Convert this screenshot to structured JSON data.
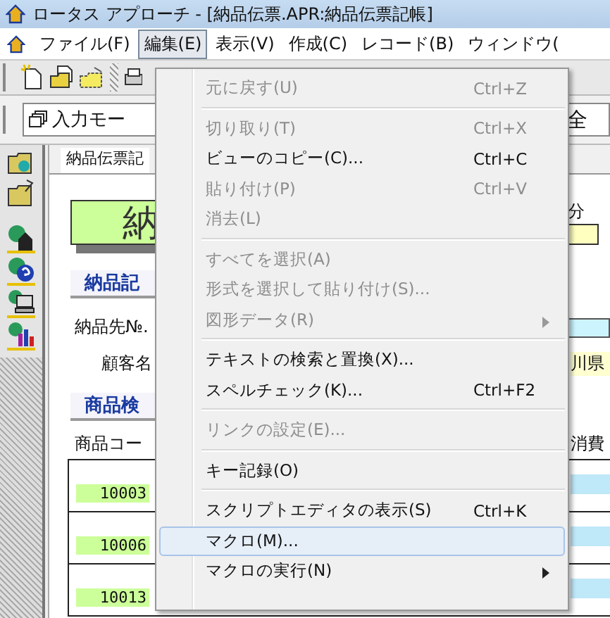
{
  "window": {
    "title": "ロータス アプローチ - [納品伝票.APR:納品伝票記帳]"
  },
  "menubar": [
    {
      "label": "ファイル(F)",
      "selected": false
    },
    {
      "label": "編集(E)",
      "selected": true
    },
    {
      "label": "表示(V)",
      "selected": false
    },
    {
      "label": "作成(C)",
      "selected": false
    },
    {
      "label": "レコード(B)",
      "selected": false
    },
    {
      "label": "ウィンドウ(",
      "selected": false
    }
  ],
  "toolbar": {
    "mode_field": "入力モー",
    "view_field": "全"
  },
  "form": {
    "tab": "納品伝票記",
    "title": "納",
    "section_1": "納品記",
    "label_1": "納品先№.",
    "label_2": "顧客名",
    "section_2": "商品検",
    "column": "商品コー",
    "right_label": "分",
    "customer_value": "川県",
    "right_column": "消費",
    "rows": [
      "10003",
      "10006",
      "10013"
    ]
  },
  "edit_menu": [
    {
      "kind": "item",
      "label": "元に戻す(U)",
      "shortcut": "Ctrl+Z",
      "disabled": true,
      "selected": false,
      "submenu": false
    },
    {
      "kind": "separator"
    },
    {
      "kind": "item",
      "label": "切り取り(T)",
      "shortcut": "Ctrl+X",
      "disabled": true,
      "selected": false,
      "submenu": false
    },
    {
      "kind": "item",
      "label": "ビューのコピー(C)...",
      "shortcut": "Ctrl+C",
      "disabled": false,
      "selected": false,
      "submenu": false
    },
    {
      "kind": "item",
      "label": "貼り付け(P)",
      "shortcut": "Ctrl+V",
      "disabled": true,
      "selected": false,
      "submenu": false
    },
    {
      "kind": "item",
      "label": "消去(L)",
      "disabled": true,
      "selected": false,
      "submenu": false
    },
    {
      "kind": "separator"
    },
    {
      "kind": "item",
      "label": "すべてを選択(A)",
      "disabled": true,
      "selected": false,
      "submenu": false
    },
    {
      "kind": "item",
      "label": "形式を選択して貼り付け(S)...",
      "disabled": true,
      "selected": false,
      "submenu": false
    },
    {
      "kind": "item",
      "label": "図形データ(R)",
      "disabled": true,
      "selected": false,
      "submenu": true
    },
    {
      "kind": "separator"
    },
    {
      "kind": "item",
      "label": "テキストの検索と置換(X)...",
      "disabled": false,
      "selected": false,
      "submenu": false
    },
    {
      "kind": "item",
      "label": "スペルチェック(K)...",
      "shortcut": "Ctrl+F2",
      "disabled": false,
      "selected": false,
      "submenu": false
    },
    {
      "kind": "separator"
    },
    {
      "kind": "item",
      "label": "リンクの設定(E)...",
      "disabled": true,
      "selected": false,
      "submenu": false
    },
    {
      "kind": "separator"
    },
    {
      "kind": "item",
      "label": "キー記録(O)",
      "disabled": false,
      "selected": false,
      "submenu": false
    },
    {
      "kind": "separator"
    },
    {
      "kind": "item",
      "label": "スクリプトエディタの表示(S)",
      "shortcut": "Ctrl+K",
      "disabled": false,
      "selected": false,
      "submenu": false
    },
    {
      "kind": "item",
      "label": "マクロ(M)...",
      "disabled": false,
      "selected": true,
      "submenu": false
    },
    {
      "kind": "item",
      "label": "マクロの実行(N)",
      "disabled": false,
      "selected": false,
      "submenu": true
    }
  ]
}
